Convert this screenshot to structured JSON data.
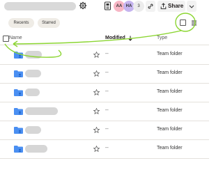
{
  "topbar": {
    "avatars": [
      {
        "initials": "AA",
        "color": "#f7b6c5"
      },
      {
        "initials": "HA",
        "color": "#c5b4ef"
      }
    ],
    "member_count": "3",
    "share_label": "Share"
  },
  "filters": {
    "chips": [
      {
        "label": "Recents"
      },
      {
        "label": "Starred"
      }
    ]
  },
  "table": {
    "columns": {
      "name": "Name",
      "modified": "Modified",
      "type": "Type"
    },
    "rows": [
      {
        "modified": "--",
        "type": "Team folder"
      },
      {
        "modified": "--",
        "type": "Team folder"
      },
      {
        "modified": "--",
        "type": "Team folder"
      },
      {
        "modified": "--",
        "type": "Team folder"
      },
      {
        "modified": "--",
        "type": "Team folder"
      },
      {
        "modified": "--",
        "type": "Team folder"
      }
    ]
  },
  "colors": {
    "folder": "#4a8ff2",
    "annotation": "#8bd531",
    "chip_bg": "#efece6"
  },
  "icons": {
    "settings": "gear-icon",
    "document": "document-icon",
    "link": "link-icon",
    "share": "share-upload-icon",
    "more": "chevron-down-icon",
    "view": "list-view-icon",
    "folder": "team-folder-icon",
    "star": "star-icon",
    "sort": "arrow-down-icon"
  }
}
